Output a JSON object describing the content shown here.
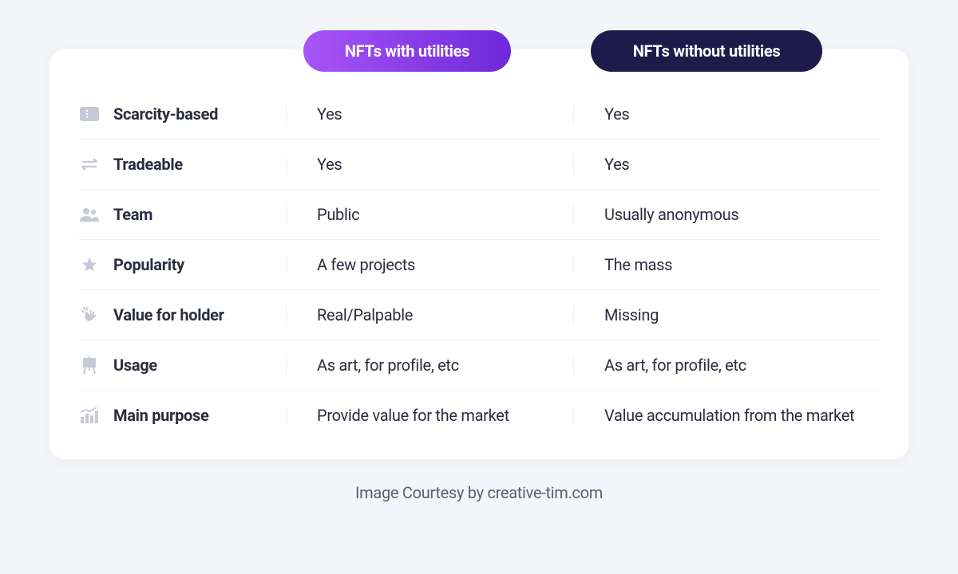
{
  "headers": {
    "with": "NFTs with utilities",
    "without": "NFTs without utilities"
  },
  "rows": [
    {
      "icon": "ticket",
      "label": "Scarcity-based",
      "with": "Yes",
      "without": "Yes"
    },
    {
      "icon": "exchange",
      "label": "Tradeable",
      "with": "Yes",
      "without": "Yes"
    },
    {
      "icon": "team",
      "label": "Team",
      "with": "Public",
      "without": "Usually anonymous"
    },
    {
      "icon": "star",
      "label": "Popularity",
      "with": "A few projects",
      "without": "The mass"
    },
    {
      "icon": "clap",
      "label": "Value for holder",
      "with": "Real/Palpable",
      "without": "Missing"
    },
    {
      "icon": "easel",
      "label": "Usage",
      "with": "As art, for profile, etc",
      "without": "As art, for profile, etc"
    },
    {
      "icon": "chart",
      "label": "Main purpose",
      "with": "Provide value for the market",
      "without": "Value accumulation from the market"
    }
  ],
  "caption": "Image Courtesy by creative-tim.com"
}
